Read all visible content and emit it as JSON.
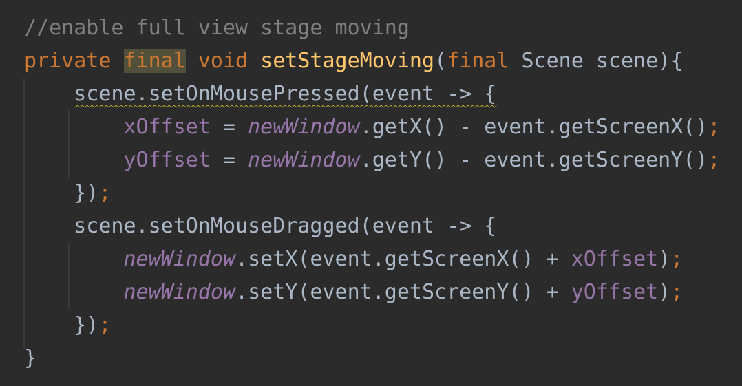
{
  "editor": {
    "lines": [
      {
        "tokens": [
          {
            "t": "//enable full view stage moving",
            "c": "cmt"
          }
        ]
      },
      {
        "tokens": [
          {
            "t": "private",
            "c": "kw"
          },
          {
            "t": " ",
            "c": ""
          },
          {
            "t": "final",
            "c": "kw hl"
          },
          {
            "t": " ",
            "c": ""
          },
          {
            "t": "void",
            "c": "kw"
          },
          {
            "t": " ",
            "c": ""
          },
          {
            "t": "setStageMoving",
            "c": "fn"
          },
          {
            "t": "(",
            "c": ""
          },
          {
            "t": "final",
            "c": "kw"
          },
          {
            "t": " Scene scene){",
            "c": ""
          }
        ]
      },
      {
        "tokens": [
          {
            "t": "    ",
            "c": ""
          },
          {
            "t": "scene.setOnMousePressed(event -> {",
            "c": "warn"
          }
        ]
      },
      {
        "tokens": [
          {
            "t": "        ",
            "c": ""
          },
          {
            "t": "xOffset",
            "c": "fld"
          },
          {
            "t": " = ",
            "c": ""
          },
          {
            "t": "newWindow",
            "c": "sfld"
          },
          {
            "t": ".getX() - event.getScreenX()",
            "c": ""
          },
          {
            "t": ";",
            "c": "semi"
          }
        ]
      },
      {
        "tokens": [
          {
            "t": "        ",
            "c": ""
          },
          {
            "t": "yOffset",
            "c": "fld"
          },
          {
            "t": " = ",
            "c": ""
          },
          {
            "t": "newWindow",
            "c": "sfld"
          },
          {
            "t": ".getY() - event.getScreenY()",
            "c": ""
          },
          {
            "t": ";",
            "c": "semi"
          }
        ]
      },
      {
        "tokens": [
          {
            "t": "    ",
            "c": ""
          },
          {
            "t": "})",
            "c": ""
          },
          {
            "t": ";",
            "c": "semi"
          }
        ]
      },
      {
        "tokens": [
          {
            "t": "    ",
            "c": ""
          },
          {
            "t": "scene.setOnMouseDragged(event -> {",
            "c": ""
          }
        ]
      },
      {
        "tokens": [
          {
            "t": "        ",
            "c": ""
          },
          {
            "t": "newWindow",
            "c": "sfld"
          },
          {
            "t": ".setX(event.getScreenX() + ",
            "c": ""
          },
          {
            "t": "xOffset",
            "c": "fld"
          },
          {
            "t": ")",
            "c": ""
          },
          {
            "t": ";",
            "c": "semi"
          }
        ]
      },
      {
        "tokens": [
          {
            "t": "        ",
            "c": ""
          },
          {
            "t": "newWindow",
            "c": "sfld"
          },
          {
            "t": ".setY(event.getScreenY() + ",
            "c": ""
          },
          {
            "t": "yOffset",
            "c": "fld"
          },
          {
            "t": ")",
            "c": ""
          },
          {
            "t": ";",
            "c": "semi"
          }
        ]
      },
      {
        "tokens": [
          {
            "t": "    ",
            "c": ""
          },
          {
            "t": "})",
            "c": ""
          },
          {
            "t": ";",
            "c": "semi"
          }
        ]
      },
      {
        "tokens": [
          {
            "t": "}",
            "c": ""
          }
        ]
      }
    ]
  },
  "colors": {
    "background": "#2b2b2b",
    "keyword": "#cc7832",
    "comment": "#808080",
    "method_declaration": "#ffc66d",
    "field": "#9876aa",
    "default_text": "#a9b7c6"
  }
}
